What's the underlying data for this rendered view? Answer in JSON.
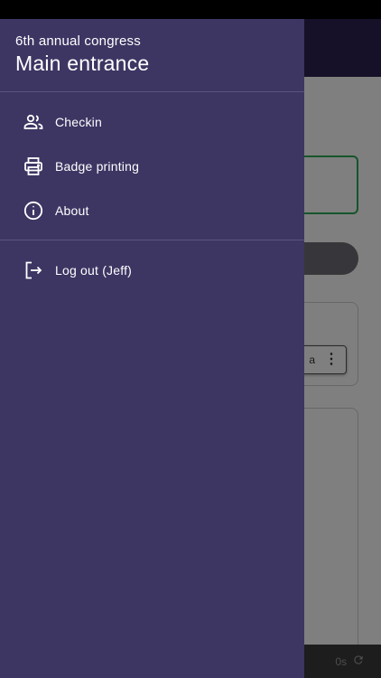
{
  "drawer": {
    "event_name": "6th annual congress",
    "location_name": "Main entrance",
    "items": [
      {
        "label": "Checkin",
        "icon": "people-icon"
      },
      {
        "label": "Badge printing",
        "icon": "printer-icon"
      },
      {
        "label": "About",
        "icon": "info-icon"
      }
    ],
    "logout_label": "Log out (Jeff)"
  },
  "background": {
    "chip_text": "a",
    "footer_timer": "0s"
  },
  "colors": {
    "drawer_bg": "#3d3663",
    "header_bg": "#2c2350",
    "accent_green": "#2eaa57"
  }
}
